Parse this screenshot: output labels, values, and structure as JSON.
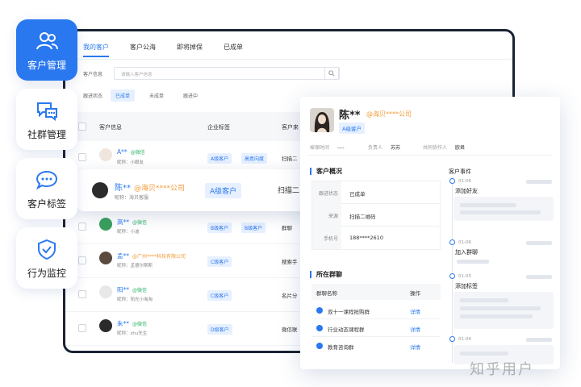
{
  "features": [
    {
      "label": "客户管理",
      "icon": "user-group-icon",
      "active": true
    },
    {
      "label": "社群管理",
      "icon": "chat-group-icon",
      "active": false
    },
    {
      "label": "客户标签",
      "icon": "chat-bubble-icon",
      "active": false
    },
    {
      "label": "行为监控",
      "icon": "shield-check-icon",
      "active": false
    }
  ],
  "tabs": [
    "我的客户",
    "客户公海",
    "即将掉保",
    "已成单"
  ],
  "search": {
    "label": "客户信息",
    "placeholder": "请输入客户信息"
  },
  "filter": {
    "label": "跟进状态",
    "options": [
      "已成单",
      "未成单",
      "跟进中"
    ]
  },
  "table": {
    "headers": [
      "客户信息",
      "企业标签",
      "客户来"
    ],
    "rows": [
      {
        "name": "A**",
        "source": "@微信",
        "source_type": "wechat",
        "nickname": "昵称：小眼友",
        "tags": [
          "A级客户",
          "高意向度"
        ],
        "channel": "扫描二"
      },
      {
        "name": "陈**",
        "source": "@海贝****公司",
        "source_type": "company",
        "nickname": "昵称：海贝客服",
        "tags": [
          "A级客户"
        ],
        "channel": "扫描二"
      },
      {
        "name": "高**",
        "source": "@微信",
        "source_type": "wechat",
        "nickname": "昵称：小迪",
        "tags": [
          "B级客户",
          "B级客户"
        ],
        "channel": "群聊"
      },
      {
        "name": "孟**",
        "source": "@广州****科技有限公司",
        "source_type": "company",
        "nickname": "昵称：孟德尔斯斯",
        "tags": [
          "C级客户"
        ],
        "channel": "搜索手"
      },
      {
        "name": "阳**",
        "source": "@微信",
        "source_type": "wechat",
        "nickname": "昵称：阳光小淘淘",
        "tags": [
          "C级客户"
        ],
        "channel": "名片分"
      },
      {
        "name": "朱**",
        "source": "@微信",
        "source_type": "wechat",
        "nickname": "昵称：zhu先生",
        "tags": [
          "D级客户"
        ],
        "channel": "微信联"
      }
    ]
  },
  "detail": {
    "name": "陈**",
    "company": "@海贝****公司",
    "tag": "A级客户",
    "meta": [
      {
        "k": "掉保时间",
        "v": "----"
      },
      {
        "k": "负责人",
        "v": "苏苏"
      },
      {
        "k": "共同协作人",
        "v": "欧君"
      }
    ],
    "overview_title": "客户概况",
    "overview": [
      {
        "k": "跟进状态",
        "v": "已成单"
      },
      {
        "k": "来源",
        "v": "扫描二维码"
      },
      {
        "k": "手机号",
        "v": "188****2610"
      }
    ],
    "groups_title": "所在群聊",
    "groups_headers": [
      "群聊名称",
      "操作"
    ],
    "groups": [
      {
        "name": "双十一课程抢购群",
        "op": "详情"
      },
      {
        "name": "行业动态课程群",
        "op": "详情"
      },
      {
        "name": "教育咨询群",
        "op": "详情"
      }
    ],
    "events_title": "客户事件",
    "events": [
      {
        "date": "01-06",
        "name": "添加好友"
      },
      {
        "date": "01-06",
        "name": "加入群聊"
      },
      {
        "date": "01-05",
        "name": "添加标签"
      },
      {
        "date": "01-04",
        "name": ""
      }
    ]
  },
  "watermark": "知乎用户",
  "colors": {
    "accent": "#2a78f0",
    "wechat": "#2fb36a",
    "company": "#f29a38"
  }
}
